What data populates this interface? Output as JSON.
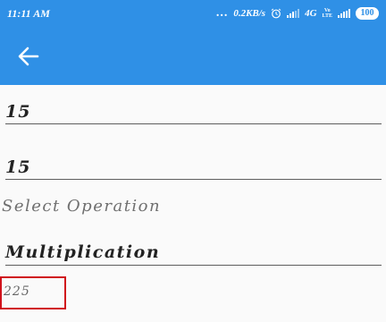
{
  "status_bar": {
    "time": "11:11 AM",
    "dots": "...",
    "speed": "0.2KB/s",
    "network": "4G",
    "volte": [
      "Vo",
      "LTE"
    ],
    "battery": "100",
    "icons": [
      "alarm-icon",
      "signal-icon",
      "signal-icon",
      "battery-icon"
    ]
  },
  "app_bar": {
    "back_icon": "arrow-left-icon",
    "color": "#2f90e6"
  },
  "form": {
    "first_number": "15",
    "second_number": "15",
    "select_label": "Select Operation",
    "operation": "Multiplication",
    "result": "225"
  },
  "colors": {
    "primary": "#2f90e6",
    "highlight_border": "#d0121b"
  }
}
